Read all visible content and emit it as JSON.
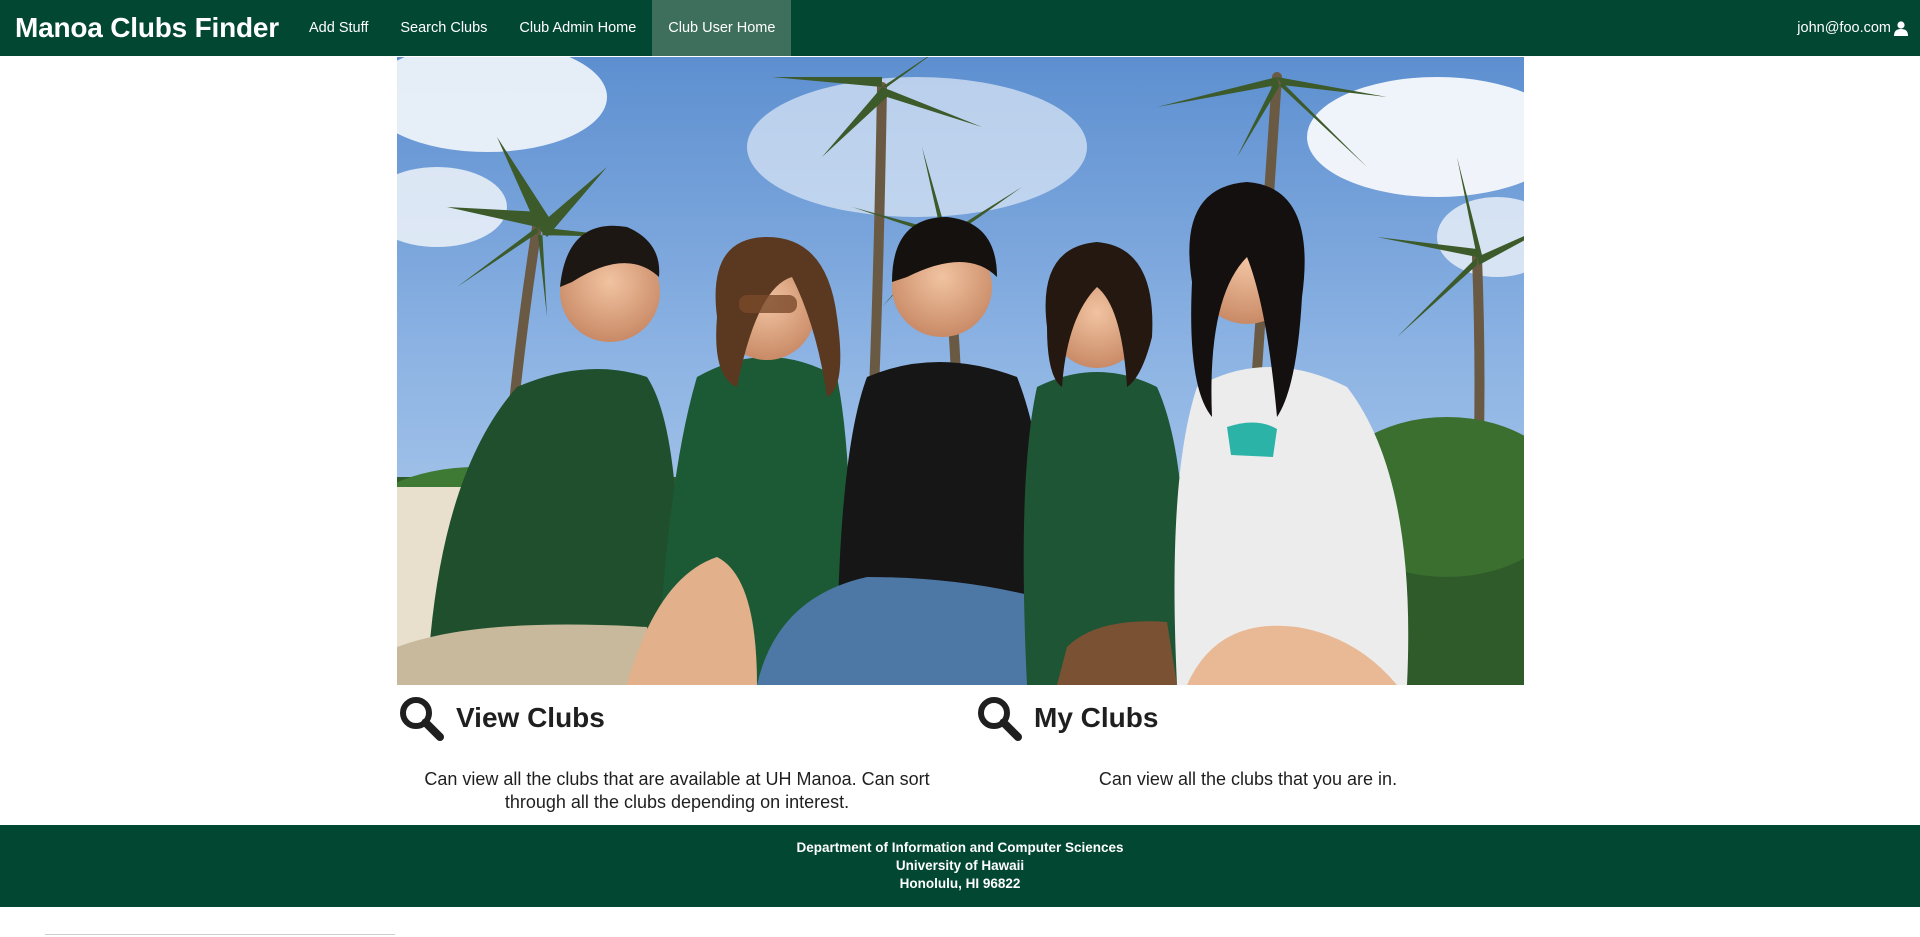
{
  "navbar": {
    "brand": "Manoa Clubs Finder",
    "items": [
      {
        "label": "Add Stuff",
        "active": false
      },
      {
        "label": "Search Clubs",
        "active": false
      },
      {
        "label": "Club Admin Home",
        "active": false
      },
      {
        "label": "Club User Home",
        "active": true
      }
    ],
    "user": "john@foo.com",
    "user_icon": "user-icon"
  },
  "hero": {
    "alt_icon": "students-photo"
  },
  "features": [
    {
      "icon": "search-icon",
      "title": "View Clubs",
      "description": "Can view all the clubs that are available at UH Manoa. Can sort through all the clubs depending on interest."
    },
    {
      "icon": "search-icon",
      "title": "My Clubs",
      "description": "Can view all the clubs that you are in."
    }
  ],
  "footer": {
    "line1": "Department of Information and Computer Sciences",
    "line2": "University of Hawaii",
    "line3": "Honolulu, HI 96822"
  },
  "colors": {
    "brand_green": "#024731",
    "active_tab": "#3e6e5c"
  }
}
